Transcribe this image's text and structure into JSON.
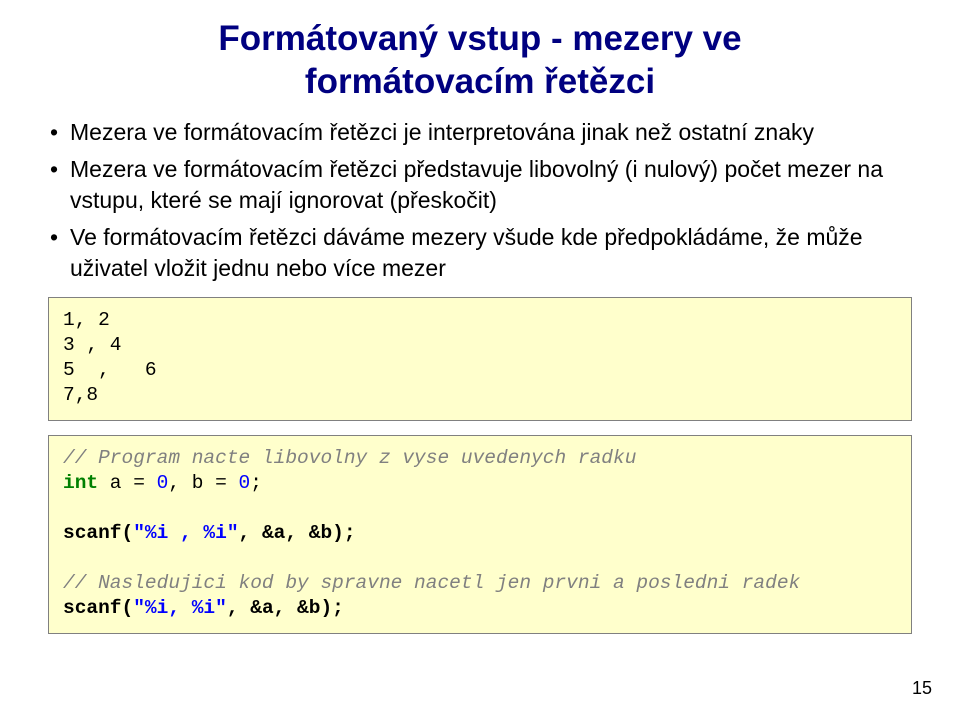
{
  "title_line1": "Formátovaný vstup - mezery ve",
  "title_line2": "formátovacím řetězci",
  "bullets": [
    "Mezera ve formátovacím řetězci je interpretována jinak než ostatní znaky",
    "Mezera ve formátovacím řetězci představuje libovolný (i nulový) počet mezer na vstupu, které se mají ignorovat (přeskočit)",
    "Ve formátovacím řetězci dáváme mezery všude kde předpokládáme, že může uživatel vložit jednu nebo více mezer"
  ],
  "code1": {
    "l1": "1, 2",
    "l2": "3 , 4",
    "l3": "5  ,   6",
    "l4": "7,8"
  },
  "code2": {
    "c1": "// Program nacte libovolny z vyse uvedenych radku",
    "kw_int": "int",
    "decl_a": " a = ",
    "zero1": "0",
    "decl_mid": ", b = ",
    "zero2": "0",
    "semi1": ";",
    "scanf1_fn": "scanf(",
    "scanf1_str": "\"%i , %i\"",
    "scanf1_args": ", &a, &b);",
    "c2": "// Nasledujici kod by spravne nacetl jen prvni a posledni radek",
    "scanf2_fn": "scanf(",
    "scanf2_str": "\"%i, %i\"",
    "scanf2_args": ", &a, &b);"
  },
  "page_number": "15"
}
